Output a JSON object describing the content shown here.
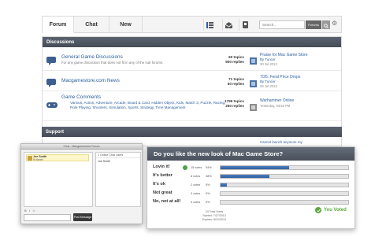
{
  "topnav": {
    "tabs": [
      {
        "label": "Forum",
        "active": true
      },
      {
        "label": "Chat",
        "active": false
      },
      {
        "label": "New",
        "active": false
      }
    ],
    "tools": [
      "list-view-icon",
      "inbox-icon",
      "bookmark-icon"
    ],
    "search": {
      "placeholder": "Search...",
      "scope": "Forums"
    },
    "settings_icon": "gear-icon"
  },
  "forum": {
    "discussions_header": "Discussions",
    "rows": [
      {
        "title": "General Game Discussions",
        "description": "For any game discussion that does not fit in any of the sub forums.",
        "topics": "60 topics",
        "replies": "900 replies",
        "last_title": "Praise for Mac Game Store",
        "last_by": "By Tuncer",
        "last_date": "30 Jul 2013"
      },
      {
        "title": "Macgamestore.com News",
        "description": "",
        "topics": "71 topics",
        "replies": "50 replies",
        "last_title": "7/26: Feral Price Drops",
        "last_by": "By Tuncer",
        "last_date": "26 Jul 2013"
      },
      {
        "title": "Game Comments",
        "description": "",
        "subforums": "Various, Action, Adventure, Arcade, Board & Card, Hidden Object, Kids, Match 3, Puzzle, Racing, Role Playing, Shooters, Simulation, Sports, Strategy, Time Management",
        "topics": "1799 topics",
        "replies": "260 replies",
        "last_title": "Warhammer Online",
        "last_by": "",
        "last_date": "Yesterday, 03:50 PM"
      }
    ],
    "support_header": "Support",
    "support_tail_1": "Cannot launch anymore my",
    "support_tail_2": "..."
  },
  "chat": {
    "title": "Chat - Macgamestore Forum",
    "message_user": "Joe Smith",
    "message_text": "Hi there!",
    "online_header": "1 Online Chat Users",
    "online_user": "Joe Smith",
    "tools": "B I ☺",
    "send_label": "Post Message"
  },
  "poll": {
    "question": "Do you like the new look of Mac Game Store?",
    "options": [
      {
        "label": "Lovin it!",
        "votes": "15 votes",
        "percent": "54%",
        "value": 0.54,
        "voted": true
      },
      {
        "label": "It's better",
        "votes": "8 votes",
        "percent": "38%",
        "value": 0.38,
        "voted": false
      },
      {
        "label": "It's ok",
        "votes": "2 votes",
        "percent": "5%",
        "value": 0.05,
        "voted": false
      },
      {
        "label": "Not great",
        "votes": "0 votes",
        "percent": "0%",
        "value": 0.0,
        "voted": false
      },
      {
        "label": "No, not at all!",
        "votes": "0 votes",
        "percent": "0%",
        "value": 0.0,
        "voted": false
      }
    ],
    "total": "24 Total Votes",
    "started": "Started: 7/27/2013",
    "expires": "Expires: 8/31/2013",
    "you_voted": "You Voted"
  },
  "colors": {
    "link": "#2a5f9e",
    "header": "#4f5763",
    "bar_fill": "#3b6db0",
    "voted": "#5aa83e"
  }
}
